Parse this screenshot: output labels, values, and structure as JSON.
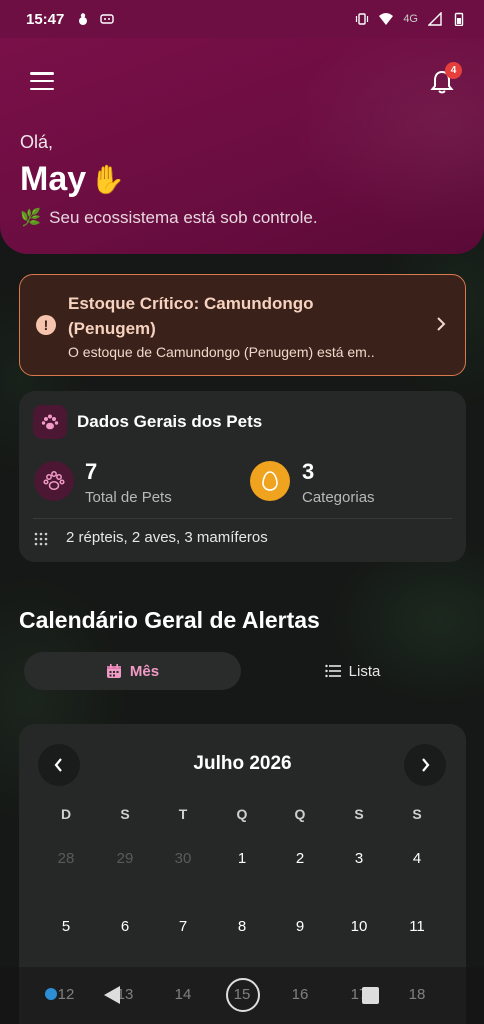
{
  "status_bar": {
    "time": "15:47",
    "network": "4G",
    "icons": [
      "notification-icon",
      "game-icon",
      "vibrate-icon",
      "wifi-icon",
      "signal-icon",
      "battery-icon"
    ]
  },
  "header": {
    "menu_icon": "menu-icon",
    "notification_count": "4",
    "greeting": "Olá,",
    "name": "May",
    "wave_emoji": "✋",
    "subtitle_emoji": "🌿",
    "subtitle": "Seu ecossistema está sob controle."
  },
  "alert": {
    "title": "Estoque Crítico: Camundongo (Penugem)",
    "body": "O estoque de Camundongo (Penugem) está em..",
    "icon": "!"
  },
  "pets": {
    "title": "Dados Gerais dos Pets",
    "total_value": "7",
    "total_label": "Total de Pets",
    "categories_value": "3",
    "categories_label": "Categorias",
    "summary": "2 répteis, 2 aves, 3 mamíferos"
  },
  "calendar": {
    "heading": "Calendário Geral de Alertas",
    "tab_month": "Mês",
    "tab_list": "Lista",
    "month_title": "Julho 2026",
    "weekdays": [
      "D",
      "S",
      "T",
      "Q",
      "Q",
      "S",
      "S"
    ],
    "row1": [
      "28",
      "29",
      "30",
      "1",
      "2",
      "3",
      "4"
    ],
    "row2": [
      "5",
      "6",
      "7",
      "8",
      "9",
      "10",
      "11"
    ],
    "row3": [
      "12",
      "13",
      "14",
      "15",
      "16",
      "17",
      "18"
    ]
  },
  "colors": {
    "header": "#6d0f42",
    "alert_border": "#d8794e",
    "accent_pink": "#f29ac6",
    "egg_orange": "#f0a31e"
  }
}
